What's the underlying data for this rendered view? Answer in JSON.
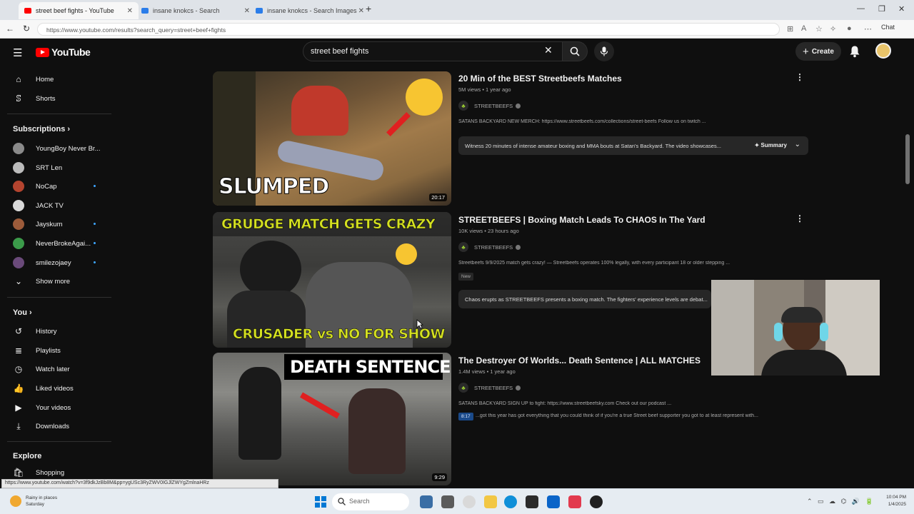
{
  "browser": {
    "tabs": [
      {
        "title": "street beef fights - YouTube",
        "active": true,
        "favicon_color": "#ff0000"
      },
      {
        "title": "insane knokcs - Search",
        "active": false,
        "favicon_color": "#2b7de9"
      },
      {
        "title": "insane knokcs - Search Images",
        "active": false,
        "favicon_color": "#2b7de9"
      }
    ],
    "new_tab_label": "+",
    "url": "https://www.youtube.com/results?search_query=street+beef+fights",
    "copilot_label": "Chat"
  },
  "youtube": {
    "logo_text": "YouTube",
    "search": {
      "value": "street beef fights"
    },
    "create_label": "Create"
  },
  "sidebar": {
    "main": [
      {
        "label": "Home",
        "icon": "home-icon",
        "glyph": "⌂"
      },
      {
        "label": "Shorts",
        "icon": "shorts-icon",
        "glyph": "ꕷ"
      }
    ],
    "subscriptions_heading": "Subscriptions",
    "subscriptions": [
      {
        "label": "YoungBoy Never Br...",
        "color": "#8a8a8a",
        "new": false
      },
      {
        "label": "SRT Len",
        "color": "#bbbbbb",
        "new": false
      },
      {
        "label": "NoCap",
        "color": "#b4442f",
        "new": true
      },
      {
        "label": "JACK TV",
        "color": "#d9d9d9",
        "new": false
      },
      {
        "label": "Jayskum",
        "color": "#9c5b3a",
        "new": true
      },
      {
        "label": "NeverBrokeAgai...",
        "color": "#3b9b4a",
        "new": true
      },
      {
        "label": "smilezojaey",
        "color": "#6a4a7a",
        "new": true
      }
    ],
    "show_more_label": "Show more",
    "you_heading": "You",
    "you": [
      {
        "label": "History",
        "icon": "history-icon",
        "glyph": "↺"
      },
      {
        "label": "Playlists",
        "icon": "playlists-icon",
        "glyph": "≣"
      },
      {
        "label": "Watch later",
        "icon": "watch-later-icon",
        "glyph": "◷"
      },
      {
        "label": "Liked videos",
        "icon": "liked-videos-icon",
        "glyph": "👍"
      },
      {
        "label": "Your videos",
        "icon": "your-videos-icon",
        "glyph": "▶"
      },
      {
        "label": "Downloads",
        "icon": "downloads-icon",
        "glyph": "⤓"
      }
    ],
    "explore_heading": "Explore",
    "explore": [
      {
        "label": "Shopping",
        "icon": "shopping-icon",
        "glyph": "🛍"
      }
    ]
  },
  "results": [
    {
      "title": "20 Min of the BEST Streetbeefs Matches",
      "meta": "5M views • 1 year ago",
      "channel": "STREETBEEFS",
      "description": "SATANS BACKYARD NEW MERCH: https://www.streetbeefs.com/collections/street-beefs Follow us on twitch ...",
      "summary": "Witness 20 minutes of intense amateur boxing and MMA bouts at Satan's Backyard. The video showcases...",
      "summary_button": "Summary",
      "duration": "20:17",
      "thumb_caption": "SLUMPED",
      "badge": ""
    },
    {
      "title": "STREETBEEFS | Boxing Match Leads To CHAOS In The Yard",
      "meta": "10K views • 23 hours ago",
      "channel": "STREETBEEFS",
      "description": "Streetbeefs 9/9/2025 match gets crazy! — Streetbeefs operates 100% legally, with every participant 18 or older stepping ...",
      "summary": "Chaos erupts as STREETBEEFS presents a boxing match. The fighters' experience levels are debat...",
      "duration": "",
      "thumb_caption": "GRUDGE MATCH GETS CRAZY",
      "thumb_caption_2": "CRUSADER vs NO FOR SHOW",
      "badge": "New"
    },
    {
      "title": "The Destroyer Of Worlds... Death Sentence | ALL MATCHES",
      "meta": "1.4M views • 1 year ago",
      "channel": "STREETBEEFS",
      "description": "SATANS BACKYARD SIGN UP to fight: https://www.streetbeefsky.com Check out our podcast ...",
      "description_2": "...got this year has got everything that you could think of if you're a true Street beef supporter you got to at least represent with...",
      "chip": "8:17",
      "duration": "9:29",
      "thumb_caption": "DEATH SENTENCE",
      "badge": ""
    }
  ],
  "status_url": "https://www.youtube.com/watch?v=3f9dkJzBb8M&pp=ygUSc3RyZWV0IGJlZWYgZmlnaHRz",
  "taskbar": {
    "weather_line1": "Rainy in places",
    "weather_line2": "Saturday",
    "search_label": "Search",
    "time": "10:04 PM",
    "date": "1/4/2025"
  },
  "colors": {
    "youtube_red": "#ff0000",
    "background": "#0f0f0f",
    "windows_accent": "#0078d4"
  }
}
